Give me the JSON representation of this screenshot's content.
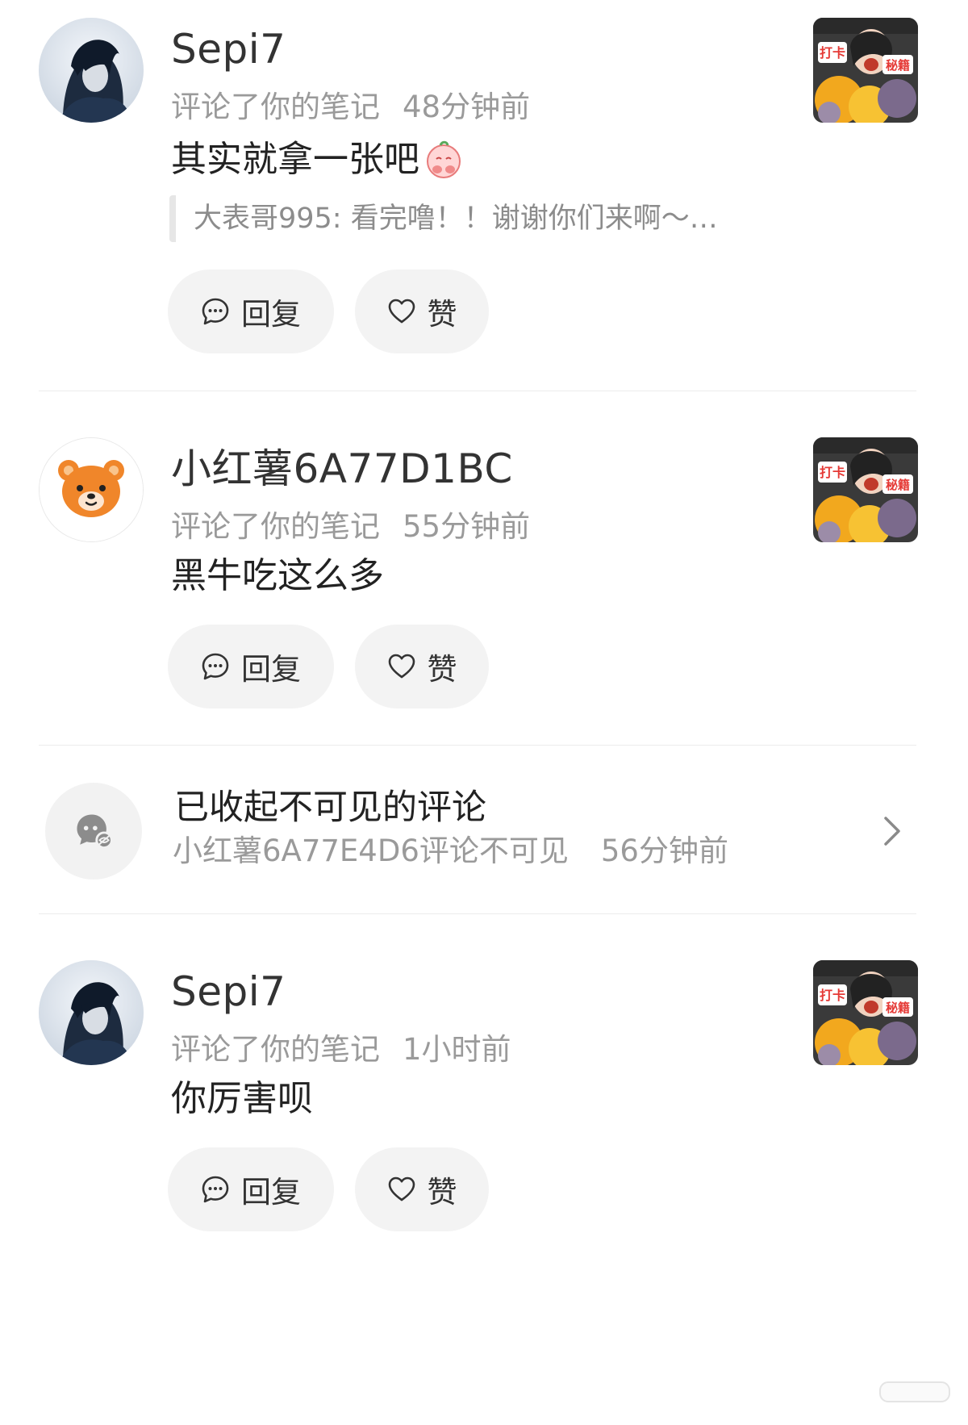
{
  "notifications": [
    {
      "username": "Sepi7",
      "action": "评论了你的笔记",
      "time": "48分钟前",
      "comment": "其实就拿一张吧",
      "quote": "大表哥995: 看完噜！！谢谢你们来啊～…",
      "reply_label": "回复",
      "like_label": "赞"
    },
    {
      "username": "小红薯6A77D1BC",
      "action": "评论了你的笔记",
      "time": "55分钟前",
      "comment": "黑牛吃这么多",
      "reply_label": "回复",
      "like_label": "赞"
    },
    {
      "username": "Sepi7",
      "action": "评论了你的笔记",
      "time": "1小时前",
      "comment": "你厉害呗",
      "reply_label": "回复",
      "like_label": "赞"
    }
  ],
  "collapsed": {
    "title": "已收起不可见的评论",
    "subtitle": "小红薯6A77E4D6评论不可见",
    "time": "56分钟前"
  },
  "thumbnail": {
    "tag_left": "打卡",
    "tag_right": "秘籍"
  },
  "icons": {
    "reply": "comment-bubble-icon",
    "like": "heart-outline-icon",
    "collapsed": "hidden-comment-icon",
    "chevron": "chevron-right-icon"
  }
}
